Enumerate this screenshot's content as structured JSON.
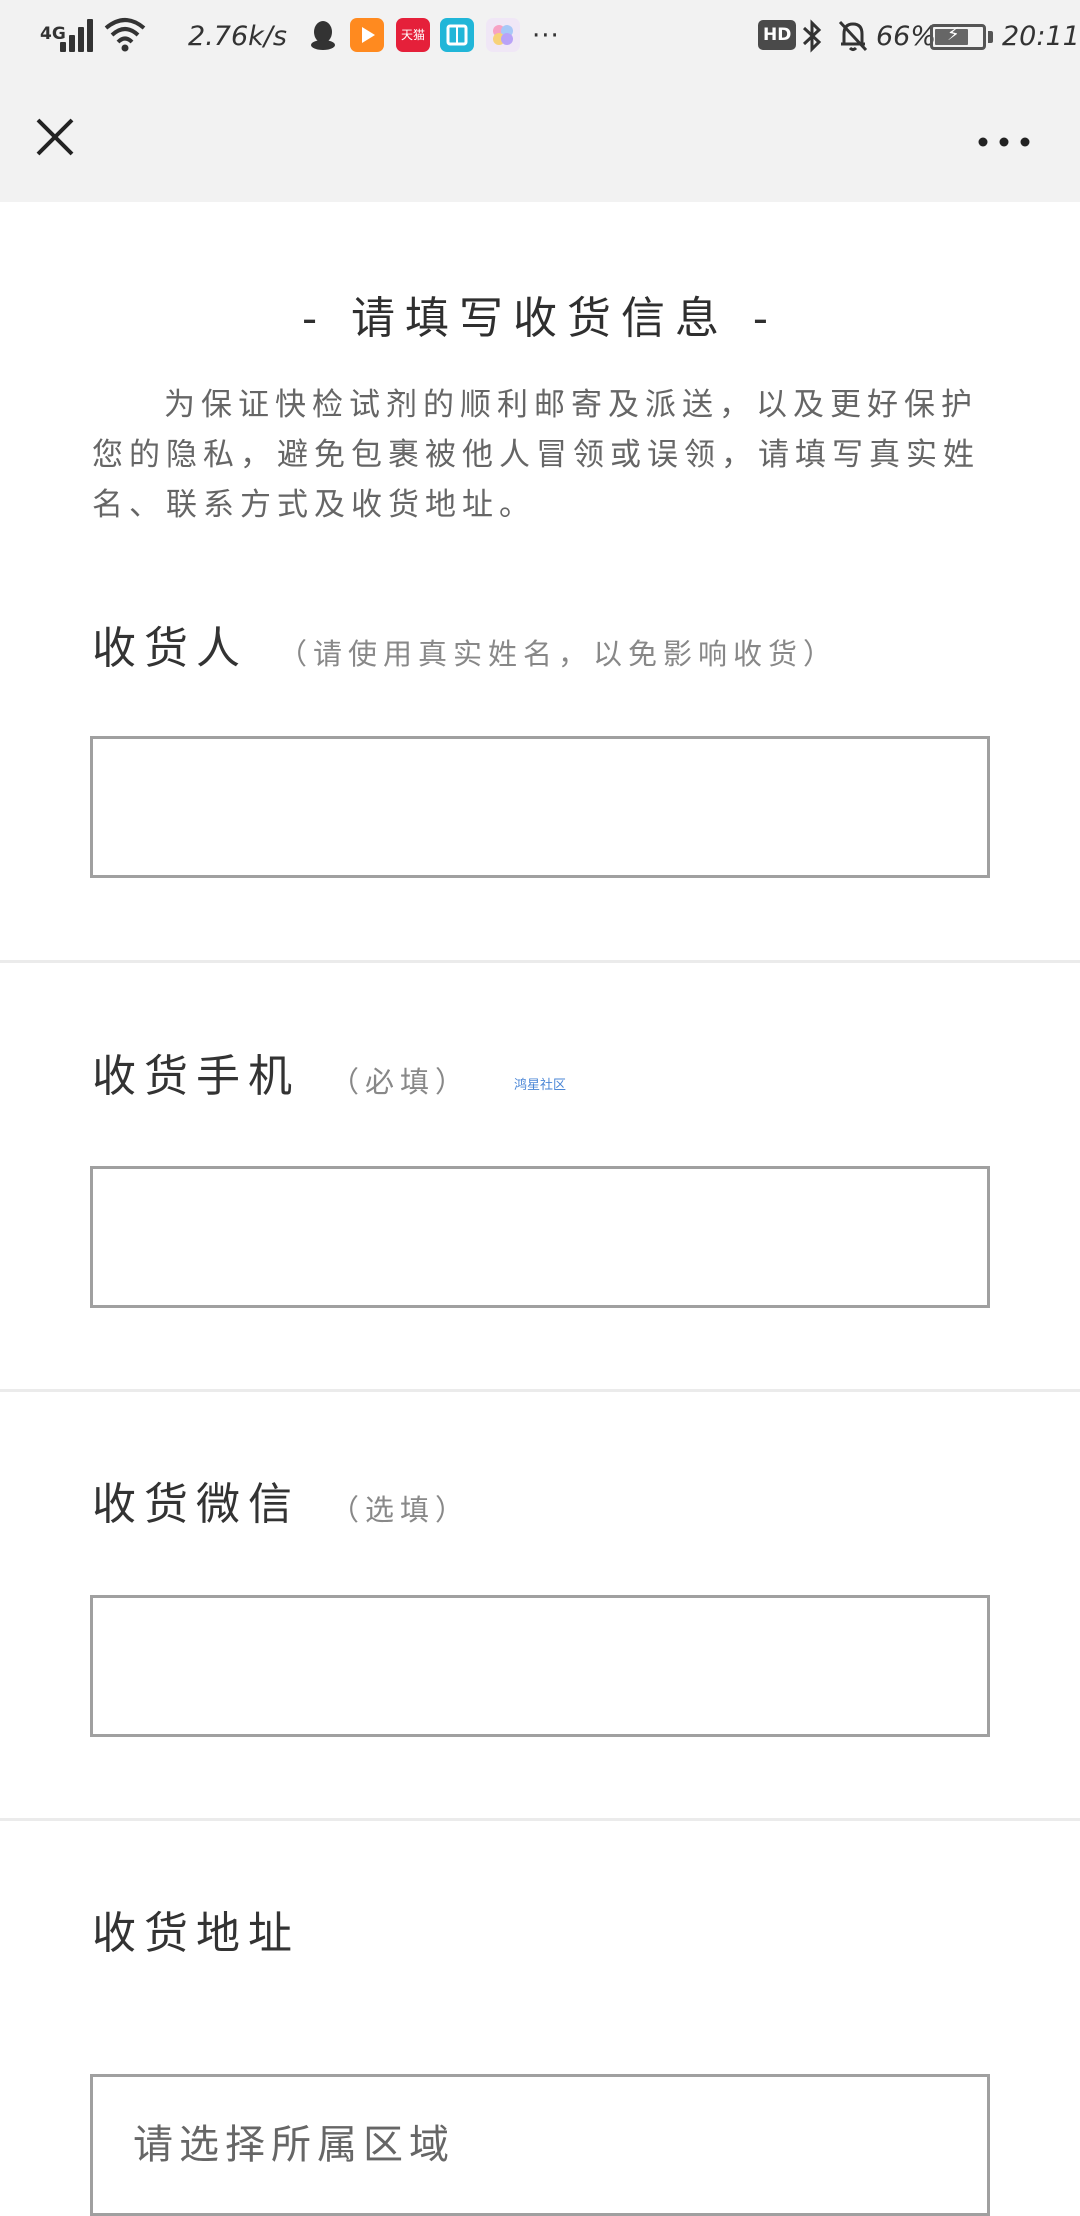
{
  "status_bar": {
    "network_type": "4G",
    "speed": "2.76k/s",
    "tmall_label": "天猫",
    "more_notifications": "···",
    "hd_label": "HD",
    "battery_percent": "66%",
    "battery_level": 0.66,
    "time": "20:11",
    "icons": [
      "signal-icon",
      "wifi-icon",
      "qq-icon",
      "video-icon",
      "tmall-icon",
      "book-icon",
      "gallery-icon",
      "bluetooth-icon",
      "mute-bell-icon",
      "battery-icon"
    ]
  },
  "nav": {
    "close_icon": "close-icon",
    "more_icon": "more-dots-icon"
  },
  "page": {
    "title": "- 请填写收货信息 -",
    "intro": "为保证快检试剂的顺利邮寄及派送，以及更好保护您的隐私，避免包裹被他人冒领或误领，请填写真实姓名、联系方式及收货地址。"
  },
  "form": {
    "receiver": {
      "label": "收货人",
      "hint": "（请使用真实姓名，以免影响收货）",
      "value": ""
    },
    "phone": {
      "label": "收货手机",
      "hint": "（必填）",
      "value": ""
    },
    "wechat": {
      "label": "收货微信",
      "hint": "（选填）",
      "value": ""
    },
    "address": {
      "label": "收货地址",
      "region_placeholder": "请选择所属区域"
    }
  },
  "watermark": "鸿星社区"
}
